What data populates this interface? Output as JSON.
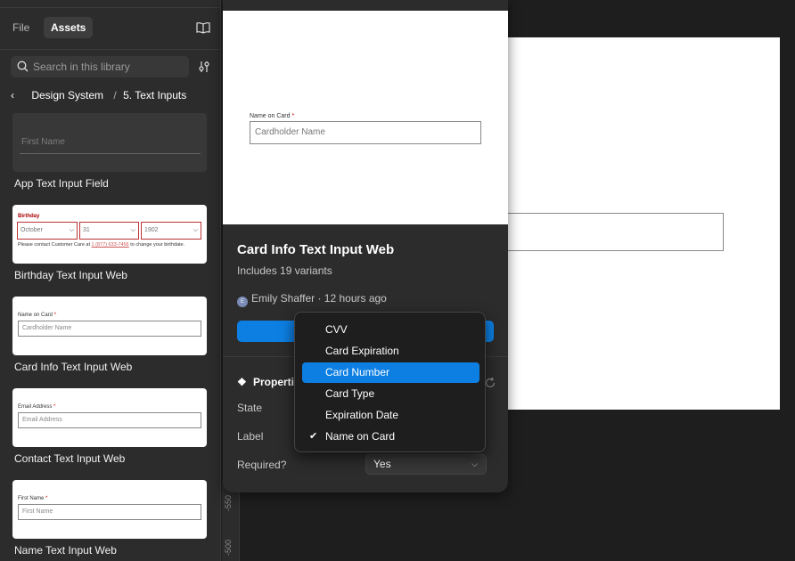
{
  "sidebar": {
    "tabs": [
      {
        "label": "File"
      },
      {
        "label": "Assets"
      }
    ],
    "search": {
      "placeholder": "Search in this library"
    },
    "breadcrumb": {
      "parent": "Design System",
      "sep": "/",
      "current": "5. Text Inputs"
    },
    "assets": [
      {
        "name": "App Text Input Field",
        "preview_placeholder": "First Name"
      },
      {
        "name": "Birthday Text Input Web",
        "preview_label": "Birthday",
        "preview_fields": [
          "October",
          "31",
          "1902"
        ],
        "preview_note_pre": "Please contact Customer Care at ",
        "preview_note_phone": "1 (877) 633-7456",
        "preview_note_post": " to change your birthdate."
      },
      {
        "name": "Card Info Text Input Web",
        "preview_label": "Name on Card",
        "preview_placeholder": "Cardholder Name"
      },
      {
        "name": "Contact Text Input Web",
        "preview_label": "Email Address",
        "preview_placeholder": "Email Address"
      },
      {
        "name": "Name Text Input Web",
        "preview_label": "First Name",
        "preview_placeholder": "First Name"
      }
    ]
  },
  "ruler": {
    "marks": [
      "-550",
      "-500"
    ]
  },
  "component": {
    "preview_label": "Name on Card",
    "required_mark": "*",
    "preview_placeholder": "Cardholder Name",
    "title": "Card Info Text Input Web",
    "variants": "Includes 19 variants",
    "author_initial": "E",
    "author": "Emily Shaffer · 12 hours ago"
  },
  "properties": {
    "header": "Properties",
    "rows": [
      {
        "label": "State"
      },
      {
        "label": "Label"
      },
      {
        "label": "Required?"
      }
    ],
    "required_value": "Yes"
  },
  "dropdown": {
    "options": [
      "CVV",
      "Card Expiration",
      "Card Number",
      "Card Type",
      "Expiration Date",
      "Name on Card"
    ],
    "highlighted": "Card Number",
    "checked": "Name on Card"
  },
  "colors": {
    "accent": "#0d7fe3",
    "required": "#cc0000"
  }
}
